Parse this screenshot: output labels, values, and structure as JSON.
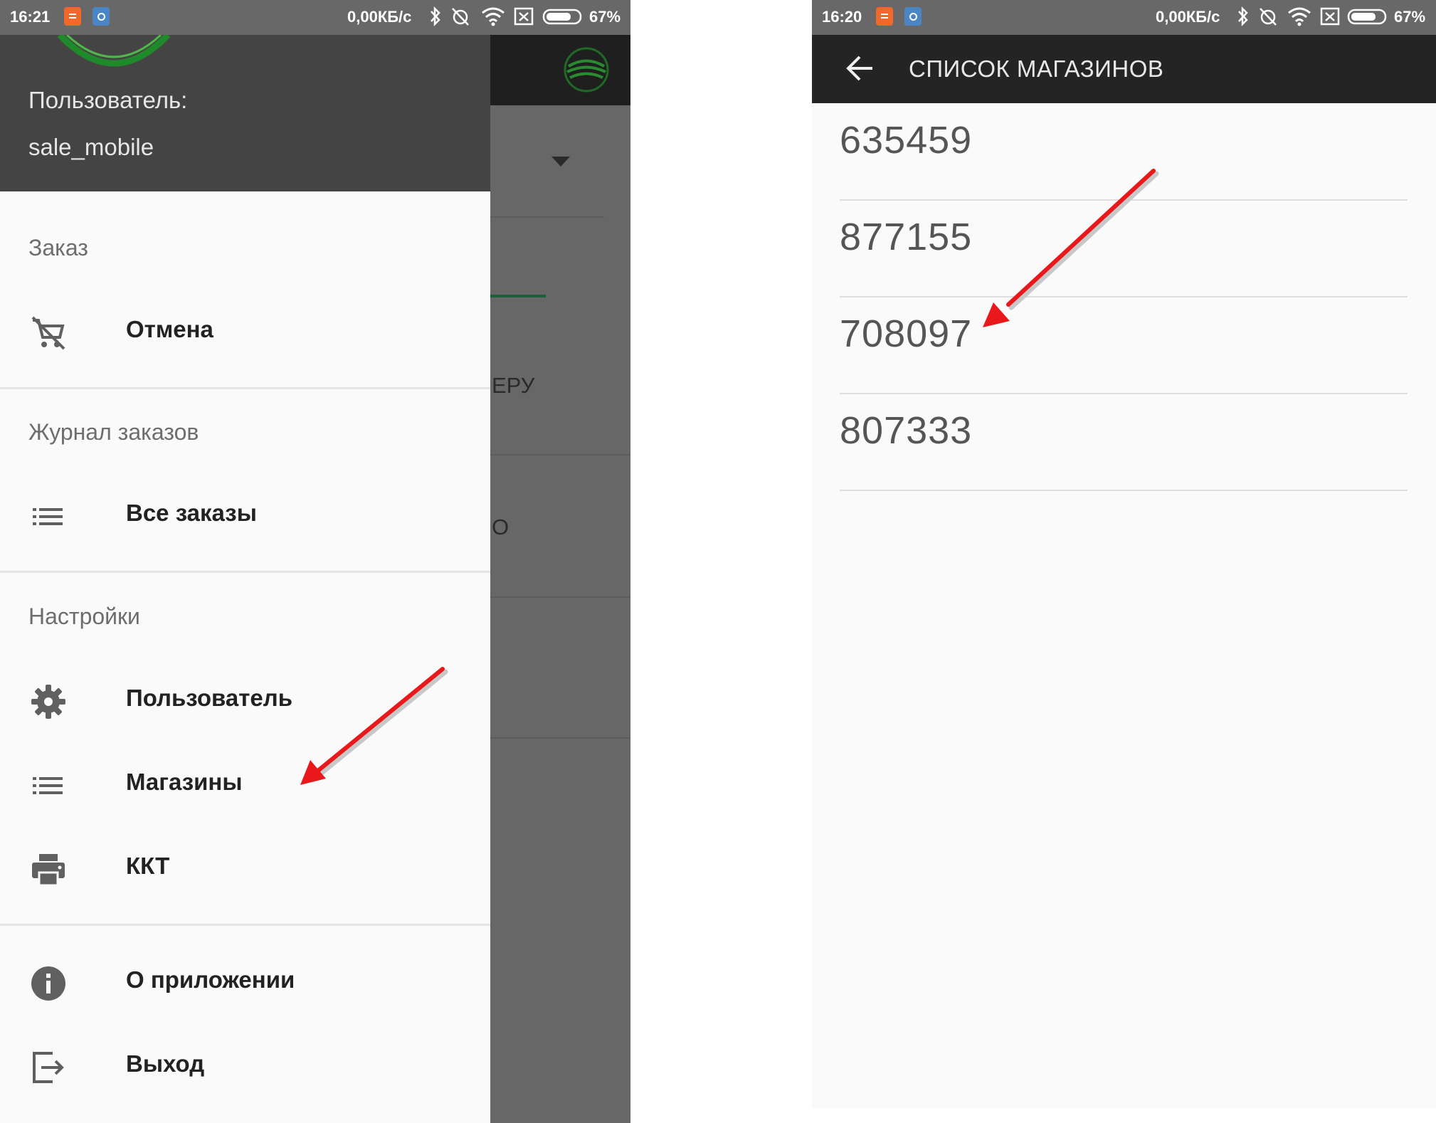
{
  "left_screen": {
    "status_bar": {
      "time": "16:21",
      "speed": "0,00КБ/с",
      "battery": "67%"
    },
    "drawer": {
      "user_label": "Пользователь:",
      "user_name": "sale_mobile",
      "sections": [
        {
          "title": "Заказ",
          "items": [
            {
              "label": "Отмена",
              "icon": "cart-off-icon"
            }
          ]
        },
        {
          "title": "Журнал заказов",
          "items": [
            {
              "label": "Все заказы",
              "icon": "list-icon"
            }
          ]
        },
        {
          "title": "Настройки",
          "items": [
            {
              "label": "Пользователь",
              "icon": "gear-icon"
            },
            {
              "label": "Магазины",
              "icon": "list-icon"
            },
            {
              "label": "ККТ",
              "icon": "printer-icon"
            }
          ]
        },
        {
          "title": "",
          "items": [
            {
              "label": "О приложении",
              "icon": "info-icon"
            },
            {
              "label": "Выход",
              "icon": "exit-icon"
            }
          ]
        }
      ]
    },
    "background_fragments": {
      "text_1": "ЕРУ",
      "text_2": "О"
    }
  },
  "right_screen": {
    "status_bar": {
      "time": "16:20",
      "speed": "0,00КБ/с",
      "battery": "67%"
    },
    "toolbar": {
      "title": "СПИСОК МАГАЗИНОВ"
    },
    "stores": [
      "635459",
      "877155",
      "708097",
      "807333"
    ]
  },
  "annotations": {
    "arrow_color": "#e8181b"
  },
  "colors": {
    "toolbar": "#242424",
    "drawer_header": "#444444",
    "logo_green": "#1f8a2a"
  }
}
